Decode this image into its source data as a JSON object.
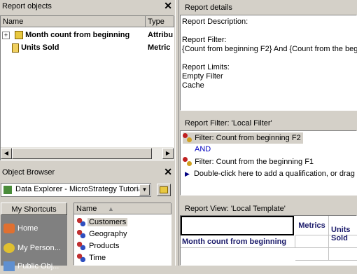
{
  "report_objects": {
    "title": "Report objects",
    "columns": [
      "Name",
      "Type"
    ],
    "rows": [
      {
        "name": "Month count from beginning",
        "type": "Attribu",
        "icon": "attribute-icon",
        "expand": "+"
      },
      {
        "name": "Units Sold",
        "type": "Metric",
        "icon": "metric-icon"
      }
    ]
  },
  "report_details": {
    "title": "Report details",
    "lines": [
      "Report Description:",
      "",
      "Report Filter:",
      "{Count from beginning F2} And {Count from the begin",
      "",
      "Report Limits:",
      "Empty Filter",
      "Cache"
    ]
  },
  "object_browser": {
    "title": "Object Browser",
    "source": "Data Explorer - MicroStrategy Tutoria",
    "shortcuts_label": "My Shortcuts",
    "shortcuts": [
      "Home",
      "My Person...",
      "Public Obj..."
    ],
    "list_header": "Name",
    "items": [
      "Customers",
      "Geography",
      "Products",
      "Time"
    ]
  },
  "report_filter": {
    "title": "Report Filter: 'Local Filter'",
    "items": [
      {
        "text": "Filter: Count from beginning F2",
        "kind": "filter"
      },
      {
        "text": "AND",
        "kind": "operator"
      },
      {
        "text": "Filter: Count from the beginning F1",
        "kind": "filter"
      },
      {
        "text": "Double-click here to add a qualification, or drag a",
        "kind": "hint"
      }
    ]
  },
  "report_view": {
    "title": "Report View: 'Local Template'",
    "metrics_label": "Metrics",
    "metric_col": "Units\nSold",
    "row_attr": "Month count from beginning"
  },
  "colors": {
    "panel": "#d4d0c8",
    "sidebar_dark": "#808080",
    "operator_blue": "#0000c0",
    "selection": "#d4d0c8"
  }
}
